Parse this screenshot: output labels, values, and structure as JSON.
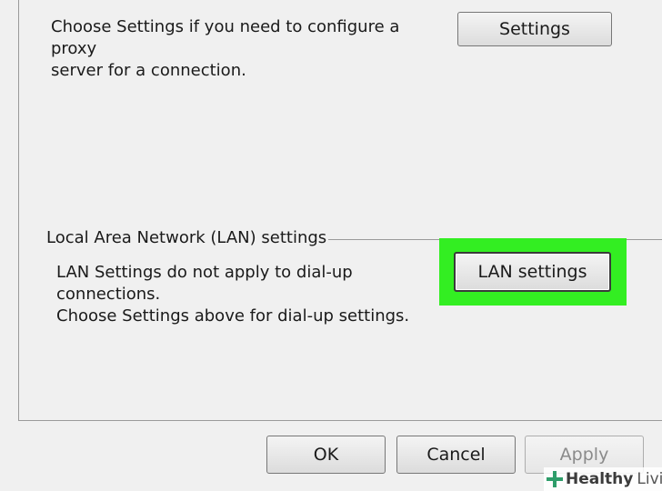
{
  "proxy": {
    "line1": "Choose Settings if you need to configure a proxy",
    "line2": "server for a connection.",
    "settings_button": "Settings"
  },
  "lan": {
    "group_title": "Local Area Network (LAN) settings",
    "line1": "LAN Settings do not apply to dial-up connections.",
    "line2": "Choose Settings above for dial-up settings.",
    "button": "LAN settings",
    "highlight_color": "#33ee22"
  },
  "footer": {
    "ok": "OK",
    "cancel": "Cancel",
    "apply": "Apply"
  },
  "watermark": {
    "brand": "Healthy",
    "brand_second": "Living",
    "logo_icon": "plus-cross-icon"
  }
}
